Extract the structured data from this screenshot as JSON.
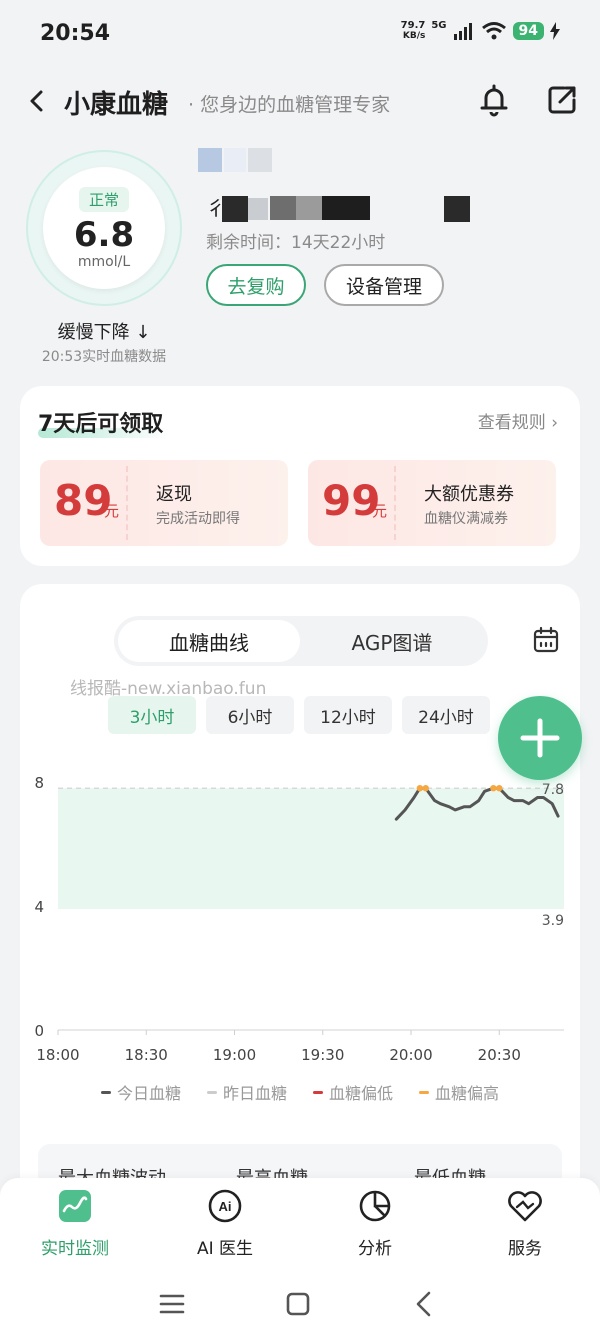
{
  "status_bar": {
    "time": "20:54",
    "net_speed": "79.7",
    "net_unit": "KB/s",
    "net_type": "5G",
    "battery": "94"
  },
  "header": {
    "title": "小康血糖",
    "subtitle": "· 您身边的血糖管理专家"
  },
  "glucose": {
    "status": "正常",
    "value": "6.8",
    "unit": "mmol/L",
    "trend": "缓慢下降",
    "trend_arrow": "↓",
    "note": "20:53实时血糖数据"
  },
  "device": {
    "name_prefix": "彳",
    "remaining": "剩余时间：14天22小时",
    "repurchase_label": "去复购",
    "manage_label": "设备管理"
  },
  "reward": {
    "title": "7天后可领取",
    "rules_label": "查看规则",
    "coupons": [
      {
        "amount": "89",
        "unit": "元",
        "title": "返现",
        "desc": "完成活动即得"
      },
      {
        "amount": "99",
        "unit": "元",
        "title": "大额优惠券",
        "desc": "血糖仪满减券"
      }
    ]
  },
  "chart_section": {
    "tabs": [
      "血糖曲线",
      "AGP图谱"
    ],
    "watermark": "线报酷-new.xianbao.fun",
    "ranges": [
      "3小时",
      "6小时",
      "12小时",
      "24小时"
    ],
    "legend": [
      "今日血糖",
      "昨日血糖",
      "血糖偏低",
      "血糖偏高"
    ],
    "stats": [
      "最大血糖波动",
      "最高血糖",
      "最低血糖"
    ]
  },
  "chart_data": {
    "type": "line",
    "x_ticks": [
      "18:00",
      "18:30",
      "19:00",
      "19:30",
      "20:00",
      "20:30"
    ],
    "y_ticks": [
      "0",
      "4",
      "8"
    ],
    "target_high": "7.8",
    "target_low": "3.9",
    "ylim": [
      0,
      8
    ],
    "series": [
      {
        "name": "今日血糖",
        "x": [
          "19:55",
          "19:58",
          "20:01",
          "20:03",
          "20:05",
          "20:08",
          "20:10",
          "20:13",
          "20:15",
          "20:18",
          "20:20",
          "20:23",
          "20:25",
          "20:28",
          "20:30",
          "20:33",
          "20:35",
          "20:38",
          "20:40",
          "20:43",
          "20:45",
          "20:48",
          "20:50"
        ],
        "y": [
          6.8,
          7.1,
          7.5,
          7.8,
          7.8,
          7.4,
          7.3,
          7.2,
          7.1,
          7.2,
          7.2,
          7.4,
          7.7,
          7.8,
          7.8,
          7.5,
          7.4,
          7.4,
          7.3,
          7.5,
          7.5,
          7.3,
          6.9
        ]
      }
    ],
    "colors": {
      "today": "#555555",
      "yesterday": "#cccccc",
      "low": "#d43c3c",
      "high": "#f5a742",
      "target_band": "#e9f7f1"
    }
  },
  "bottom_nav": [
    {
      "label": "实时监测",
      "icon": "realtime-monitor-icon"
    },
    {
      "label": "AI 医生",
      "icon": "ai-doctor-icon"
    },
    {
      "label": "分析",
      "icon": "analysis-pie-icon"
    },
    {
      "label": "服务",
      "icon": "service-heart-icon"
    }
  ]
}
